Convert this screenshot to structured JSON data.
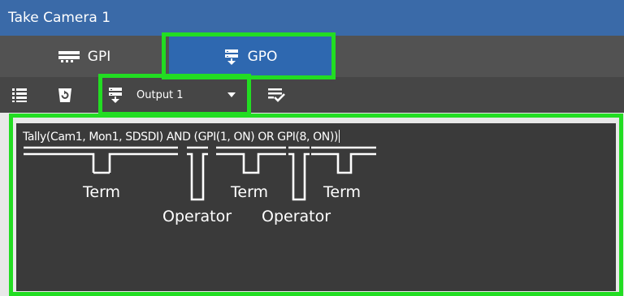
{
  "window": {
    "title": "Take Camera 1"
  },
  "tabs": [
    {
      "label": "GPI",
      "icon": "gpi-icon",
      "active": false
    },
    {
      "label": "GPO",
      "icon": "gpo-icon",
      "active": true
    }
  ],
  "toolbar": {
    "buttons": [
      {
        "icon": "list-icon"
      },
      {
        "icon": "reset-icon"
      },
      {
        "icon": "apply-check-icon"
      }
    ],
    "output_select": {
      "icon": "gpo-icon",
      "value": "Output 1"
    }
  },
  "editor": {
    "expression": "Tally(Cam1, Mon1, SDSDI) AND (GPI(1, ON) OR GPI(8, ON))"
  },
  "annotations": [
    {
      "label": "Term"
    },
    {
      "label": "Operator"
    },
    {
      "label": "Term"
    },
    {
      "label": "Operator"
    },
    {
      "label": "Term"
    }
  ],
  "colors": {
    "title_bar": "#3a6aa8",
    "active_tab": "#2e68b0",
    "highlight": "#22dd22",
    "editor_bg": "#3a3a3a"
  }
}
